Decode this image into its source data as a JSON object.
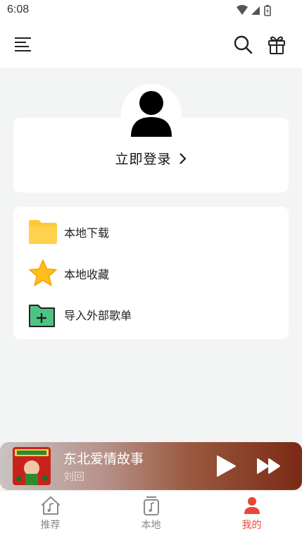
{
  "status_bar": {
    "time": "6:08",
    "icons": [
      "wifi-icon",
      "signal-icon",
      "battery-icon"
    ]
  },
  "header": {
    "icons": [
      "menu-icon",
      "search-icon",
      "gift-icon"
    ]
  },
  "login": {
    "label": "立即登录"
  },
  "menu": {
    "items": [
      {
        "label": "本地下载",
        "icon": "folder-icon"
      },
      {
        "label": "本地收藏",
        "icon": "star-icon"
      },
      {
        "label": "导入外部歌单",
        "icon": "folder-add-icon"
      }
    ]
  },
  "player": {
    "title": "东北爱情故事",
    "artist": "刘回"
  },
  "tabs": [
    {
      "label": "推荐",
      "icon": "home-music-icon"
    },
    {
      "label": "本地",
      "icon": "music-file-icon"
    },
    {
      "label": "我的",
      "icon": "person-icon",
      "active": true
    }
  ],
  "colors": {
    "accent": "#e8463a",
    "folder": "#ffc933",
    "star": "#ffbe1a",
    "import_green": "#4cc584"
  }
}
